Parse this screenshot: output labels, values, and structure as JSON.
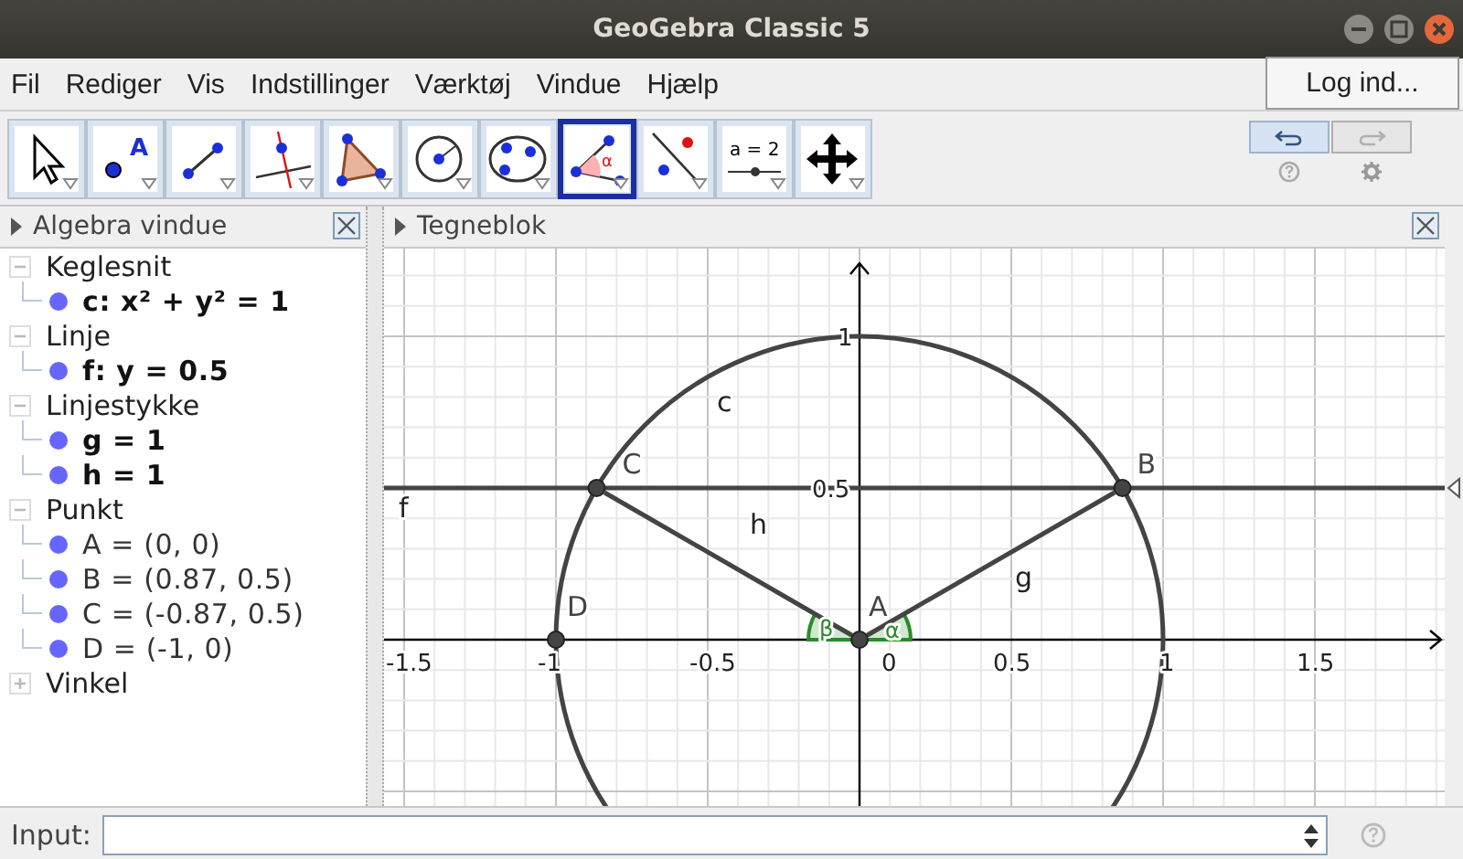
{
  "window": {
    "title": "GeoGebra Classic 5"
  },
  "menu": [
    "Fil",
    "Rediger",
    "Vis",
    "Indstillinger",
    "Værktøj",
    "Vindue",
    "Hjælp"
  ],
  "login_button": "Log ind...",
  "toolbar": {
    "tools": [
      {
        "kind": "move",
        "selected": false
      },
      {
        "kind": "point",
        "selected": false
      },
      {
        "kind": "segment",
        "selected": false
      },
      {
        "kind": "perpendicular",
        "selected": false
      },
      {
        "kind": "polygon",
        "selected": false
      },
      {
        "kind": "circle",
        "selected": false
      },
      {
        "kind": "conic",
        "selected": false
      },
      {
        "kind": "angle",
        "selected": true
      },
      {
        "kind": "reflect",
        "selected": false
      },
      {
        "kind": "slider",
        "selected": false
      },
      {
        "kind": "move-view",
        "selected": false
      }
    ],
    "undo_enabled": true,
    "redo_enabled": false,
    "slider_label": "a = 2",
    "angle_label": "α",
    "point_label": "A"
  },
  "algebra": {
    "title": "Algebra vindue",
    "groups": [
      {
        "label": "Keglesnit",
        "expanded": true,
        "children": [
          {
            "text": "c: x² + y² = 1",
            "bold": true
          }
        ]
      },
      {
        "label": "Linje",
        "expanded": true,
        "children": [
          {
            "text": "f: y = 0.5",
            "bold": true
          }
        ]
      },
      {
        "label": "Linjestykke",
        "expanded": true,
        "children": [
          {
            "text": "g = 1",
            "bold": true
          },
          {
            "text": "h = 1",
            "bold": true
          }
        ]
      },
      {
        "label": "Punkt",
        "expanded": true,
        "children": [
          {
            "text": "A = (0, 0)",
            "bold": false
          },
          {
            "text": "B = (0.87, 0.5)",
            "bold": false
          },
          {
            "text": "C = (-0.87, 0.5)",
            "bold": false
          },
          {
            "text": "D = (-1, 0)",
            "bold": false
          }
        ]
      },
      {
        "label": "Vinkel",
        "expanded": false
      }
    ]
  },
  "graphics": {
    "title": "Tegneblok",
    "x_tick_labels": [
      "-1.5",
      "-1",
      "-0.5",
      "0",
      "0.5",
      "1",
      "1.5"
    ],
    "y_tick_labels": [
      "1",
      "0.5"
    ],
    "object_labels": [
      "c",
      "f",
      "h",
      "g"
    ],
    "point_labels": [
      "C",
      "B",
      "D",
      "A"
    ],
    "angle_labels": [
      "β",
      "α"
    ]
  },
  "input_bar": {
    "label": "Input:"
  }
}
